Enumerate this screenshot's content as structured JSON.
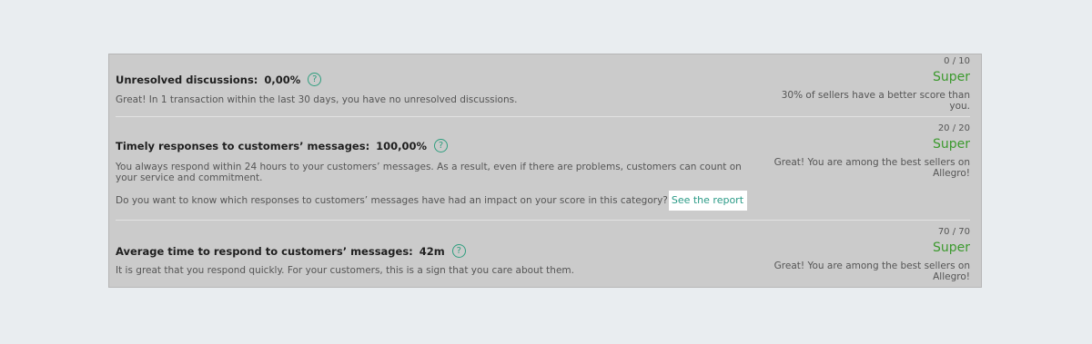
{
  "metrics": [
    {
      "title": "Unresolved discussions:",
      "value": "0,00%",
      "description": "Great! In 1 transaction within the last 30 days, you have no unresolved discussions.",
      "score": "0 / 10",
      "grade": "Super",
      "note": "30% of sellers have a better score than you."
    },
    {
      "title": "Timely responses to customers’ messages:",
      "value": "100,00%",
      "description": "You always respond within 24 hours to your customers’ messages. As a result, even if there are problems, customers can count on your service and commitment.",
      "question": "Do you want to know which responses to customers’ messages have had an impact on your score in this category?",
      "link_label": "See the report",
      "score": "20 / 20",
      "grade": "Super",
      "note": "Great! You are among the best sellers on Allegro!"
    },
    {
      "title": "Average time to respond to customers’ messages:",
      "value": "42m",
      "description": "It is great that you respond quickly. For your customers, this is a sign that you care about them.",
      "score": "70 / 70",
      "grade": "Super",
      "note": "Great! You are among the best sellers on Allegro!"
    }
  ],
  "help_icon_glyph": "?",
  "colors": {
    "accent_green": "#3c9a2e",
    "link_teal": "#2a9a86",
    "panel_bg": "#cbcbcb"
  }
}
